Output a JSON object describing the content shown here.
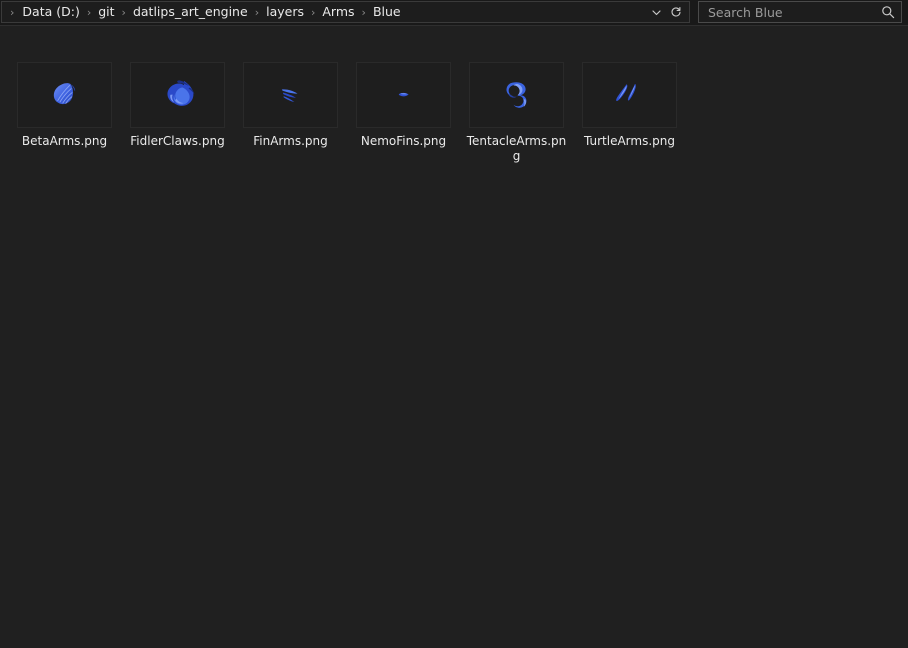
{
  "window": {
    "background_color": "#202020",
    "topbar_color": "#191919"
  },
  "address_bar": {
    "separator_glyph": "›",
    "breadcrumbs": [
      {
        "label": "Data (D:)"
      },
      {
        "label": "git"
      },
      {
        "label": "datlips_art_engine"
      },
      {
        "label": "layers"
      },
      {
        "label": "Arms"
      },
      {
        "label": "Blue"
      }
    ],
    "dropdown_icon": "chevron-down-icon",
    "refresh_icon": "refresh-icon"
  },
  "search": {
    "placeholder": "Search Blue",
    "value": "",
    "icon": "search-icon"
  },
  "files": {
    "accent_color": "#3a63e0",
    "items": [
      {
        "name": "BetaArms.png",
        "icon": "fan-shell-thumbnail"
      },
      {
        "name": "FidlerClaws.png",
        "icon": "crab-claw-thumbnail"
      },
      {
        "name": "FinArms.png",
        "icon": "fin-thumbnail"
      },
      {
        "name": "NemoFins.png",
        "icon": "small-fin-thumbnail"
      },
      {
        "name": "TentacleArms.png",
        "icon": "tentacle-thumbnail"
      },
      {
        "name": "TurtleArms.png",
        "icon": "flipper-thumbnail"
      }
    ]
  }
}
